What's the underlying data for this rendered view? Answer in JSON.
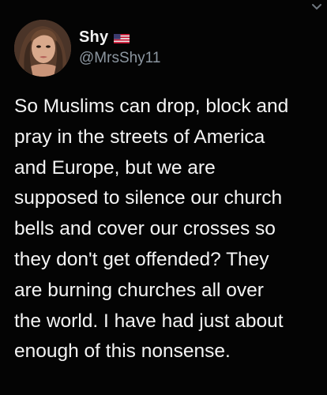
{
  "user": {
    "display_name": "Shy",
    "handle": "@MrsShy11",
    "avatar_icon": "profile-photo",
    "flag_icon": "us-flag-icon"
  },
  "tweet": {
    "lines": [
      "So Muslims can drop, block and",
      "pray in the streets of America",
      "and Europe, but we are",
      "supposed to silence our church",
      "bells and cover our crosses so",
      "they don't get offended? They",
      "are burning churches all over",
      "the world.  I have had just about",
      "enough of this nonsense."
    ]
  },
  "colors": {
    "background": "#040404",
    "text": "#f4f4f4",
    "handle": "#8c96a0"
  }
}
